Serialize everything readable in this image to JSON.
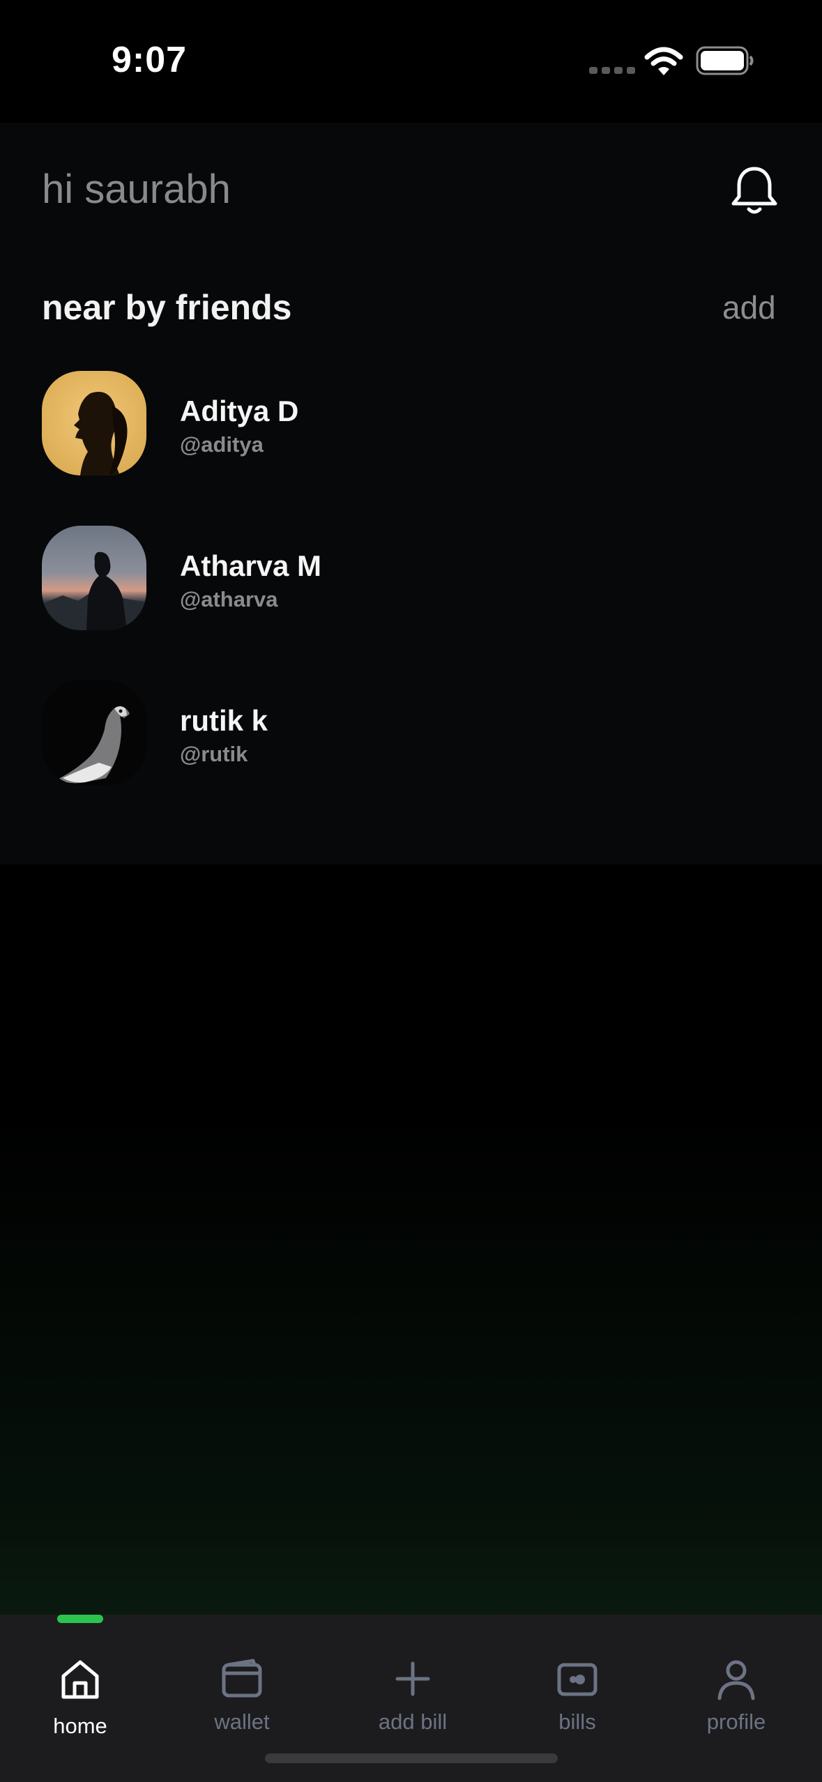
{
  "status_bar": {
    "time": "9:07"
  },
  "header": {
    "greeting": "hi saurabh",
    "bell_icon": "bell-icon"
  },
  "friends": {
    "title": "near by friends",
    "add_label": "add",
    "items": [
      {
        "name": "Aditya D",
        "handle": "@aditya"
      },
      {
        "name": "Atharva M",
        "handle": "@atharva"
      },
      {
        "name": "rutik k",
        "handle": "@rutik"
      }
    ]
  },
  "tabs": [
    {
      "label": "home",
      "icon": "home-icon",
      "active": true
    },
    {
      "label": "wallet",
      "icon": "wallet-icon",
      "active": false
    },
    {
      "label": "add bill",
      "icon": "plus-icon",
      "active": false
    },
    {
      "label": "bills",
      "icon": "bill-icon",
      "active": false
    },
    {
      "label": "profile",
      "icon": "user-icon",
      "active": false
    }
  ],
  "colors": {
    "accent": "#2cc44e",
    "tab_inactive": "#6c7384",
    "card_bg": "#07080a",
    "tab_bar_bg": "#1c1c1e"
  }
}
